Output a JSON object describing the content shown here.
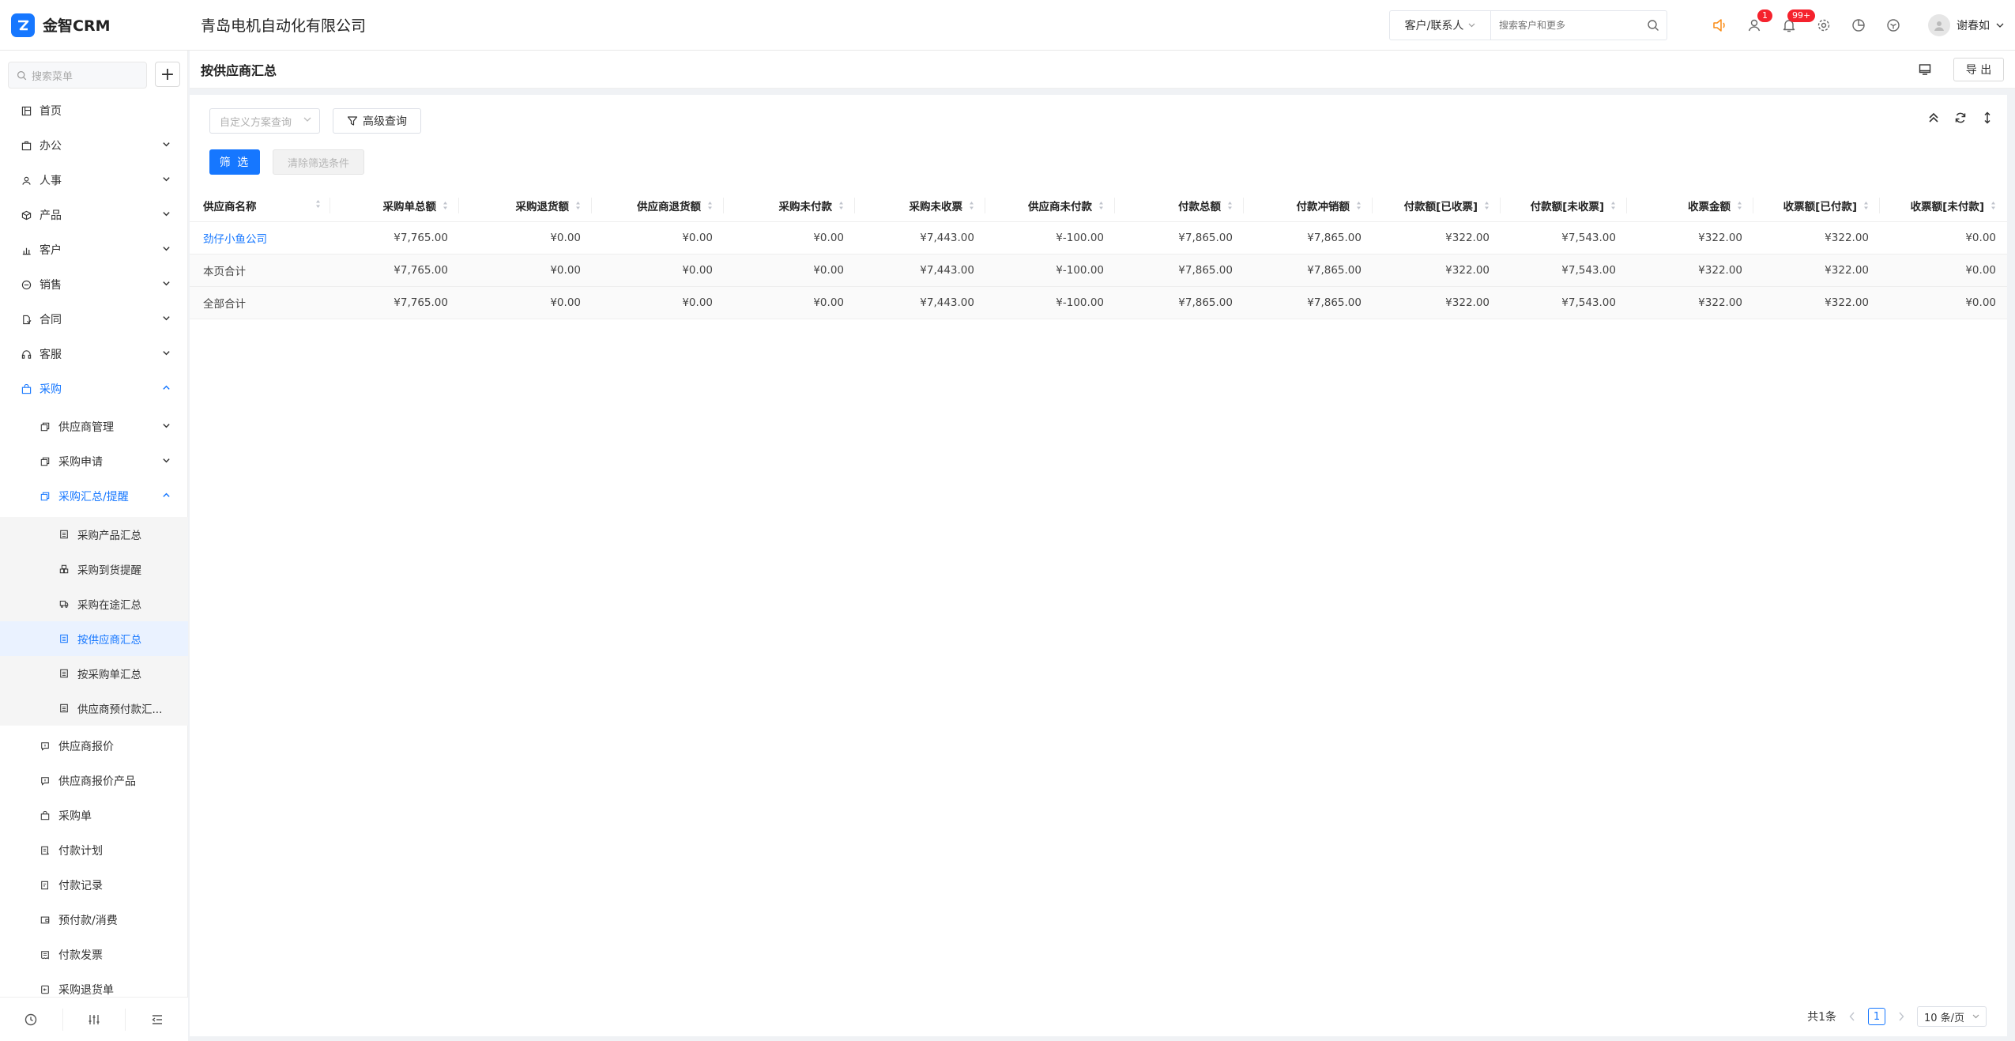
{
  "app": {
    "name": "金智CRM",
    "company": "青岛电机自动化有限公司"
  },
  "topbar": {
    "search_type": "客户/联系人",
    "search_placeholder": "搜索客户和更多",
    "badge_contacts": "1",
    "badge_notifications": "99+",
    "user_name": "谢春如"
  },
  "sidebar": {
    "search_placeholder": "搜索菜单",
    "add_label": "+",
    "items": [
      {
        "label": "首页"
      },
      {
        "label": "办公"
      },
      {
        "label": "人事"
      },
      {
        "label": "产品"
      },
      {
        "label": "客户"
      },
      {
        "label": "销售"
      },
      {
        "label": "合同"
      },
      {
        "label": "客服"
      },
      {
        "label": "采购"
      }
    ],
    "purchase_children": [
      {
        "label": "供应商管理"
      },
      {
        "label": "采购申请"
      },
      {
        "label": "采购汇总/提醒"
      }
    ],
    "summary_children": [
      {
        "label": "采购产品汇总"
      },
      {
        "label": "采购到货提醒"
      },
      {
        "label": "采购在途汇总"
      },
      {
        "label": "按供应商汇总"
      },
      {
        "label": "按采购单汇总"
      },
      {
        "label": "供应商预付款汇..."
      }
    ],
    "purchase_more": [
      {
        "label": "供应商报价"
      },
      {
        "label": "供应商报价产品"
      },
      {
        "label": "采购单"
      },
      {
        "label": "付款计划"
      },
      {
        "label": "付款记录"
      },
      {
        "label": "预付款/消费"
      },
      {
        "label": "付款发票"
      },
      {
        "label": "采购退货单"
      }
    ]
  },
  "page": {
    "title": "按供应商汇总",
    "export_label": "导 出"
  },
  "filters": {
    "custom_query_placeholder": "自定义方案查询",
    "advanced_label": "高级查询",
    "filter_label": "筛 选",
    "clear_label": "清除筛选条件"
  },
  "table": {
    "columns": [
      "供应商名称",
      "采购单总额",
      "采购退货额",
      "供应商退货额",
      "采购未付款",
      "采购未收票",
      "供应商未付款",
      "付款总额",
      "付款冲销额",
      "付款额[已收票]",
      "付款额[未收票]",
      "收票金额",
      "收票额[已付款]",
      "收票额[未付款]"
    ],
    "rows": [
      [
        "劲仔小鱼公司",
        "¥7,765.00",
        "¥0.00",
        "¥0.00",
        "¥0.00",
        "¥7,443.00",
        "¥-100.00",
        "¥7,865.00",
        "¥7,865.00",
        "¥322.00",
        "¥7,543.00",
        "¥322.00",
        "¥322.00",
        "¥0.00"
      ],
      [
        "本页合计",
        "¥7,765.00",
        "¥0.00",
        "¥0.00",
        "¥0.00",
        "¥7,443.00",
        "¥-100.00",
        "¥7,865.00",
        "¥7,865.00",
        "¥322.00",
        "¥7,543.00",
        "¥322.00",
        "¥322.00",
        "¥0.00"
      ],
      [
        "全部合计",
        "¥7,765.00",
        "¥0.00",
        "¥0.00",
        "¥0.00",
        "¥7,443.00",
        "¥-100.00",
        "¥7,865.00",
        "¥7,865.00",
        "¥322.00",
        "¥7,543.00",
        "¥322.00",
        "¥322.00",
        "¥0.00"
      ]
    ]
  },
  "pagination": {
    "total": "共1条",
    "current": "1",
    "page_size": "10 条/页"
  },
  "colors": {
    "primary": "#1677ff",
    "badge": "#f5222d",
    "speaker": "#fa8c16"
  }
}
